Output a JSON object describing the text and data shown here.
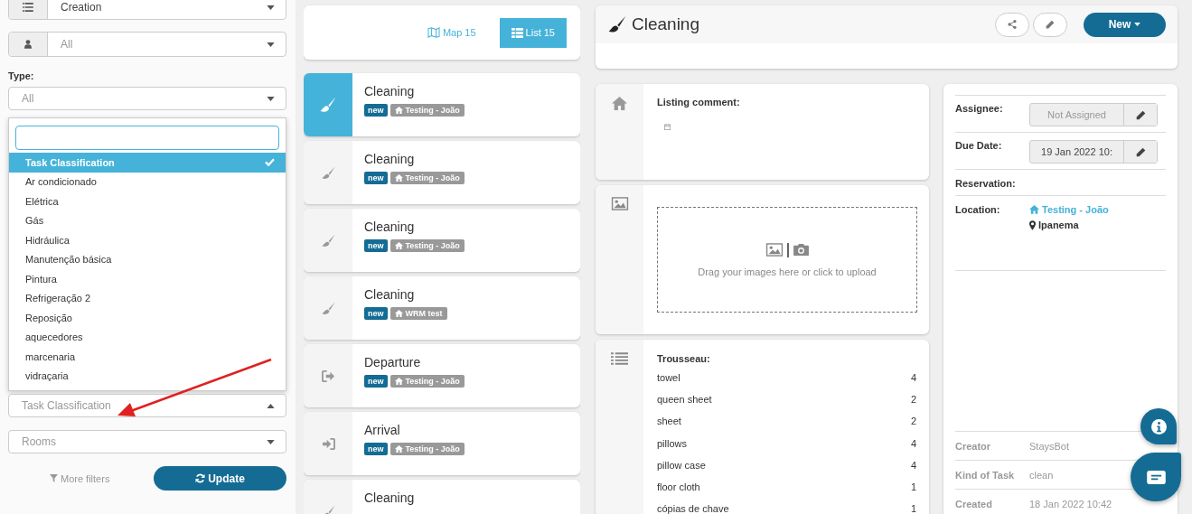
{
  "filters": {
    "order_select": {
      "value": "Creation"
    },
    "person_select": {
      "value": "All"
    },
    "type": {
      "label": "Type:",
      "value": "All"
    },
    "classification_select": {
      "placeholder": "Task Classification",
      "expanded": true
    },
    "classification_options": [
      {
        "label": "Task Classification",
        "selected": true
      },
      {
        "label": "Ar condicionado",
        "selected": false
      },
      {
        "label": "Elétrica",
        "selected": false
      },
      {
        "label": "Gás",
        "selected": false
      },
      {
        "label": "Hidráulica",
        "selected": false
      },
      {
        "label": "Manutenção básica",
        "selected": false
      },
      {
        "label": "Pintura",
        "selected": false
      },
      {
        "label": "Refrigeração 2",
        "selected": false
      },
      {
        "label": "Reposição",
        "selected": false
      },
      {
        "label": "aquecedores",
        "selected": false
      },
      {
        "label": "marcenaria",
        "selected": false
      },
      {
        "label": "vidraçaria",
        "selected": false
      }
    ],
    "rooms_select": {
      "placeholder": "Rooms"
    },
    "more_filters": "More filters",
    "update_button": "Update"
  },
  "view_toggle": [
    {
      "label": "Map 15",
      "kind": "map",
      "selected": false
    },
    {
      "label": "List 15",
      "kind": "list",
      "selected": true
    }
  ],
  "tasks": [
    {
      "title": "Cleaning",
      "kind": "cleaning",
      "selected": true,
      "status": "new",
      "location": "Testing - João"
    },
    {
      "title": "Cleaning",
      "kind": "cleaning",
      "selected": false,
      "status": "new",
      "location": "Testing - João"
    },
    {
      "title": "Cleaning",
      "kind": "cleaning",
      "selected": false,
      "status": "new",
      "location": "Testing - João"
    },
    {
      "title": "Cleaning",
      "kind": "cleaning",
      "selected": false,
      "status": "new",
      "location": "WRM test"
    },
    {
      "title": "Departure",
      "kind": "departure",
      "selected": false,
      "status": "new",
      "location": "Testing - João"
    },
    {
      "title": "Arrival",
      "kind": "arrival",
      "selected": false,
      "status": "new",
      "location": "Testing - João"
    },
    {
      "title": "Cleaning",
      "kind": "cleaning",
      "selected": false
    }
  ],
  "detail": {
    "title": "Cleaning",
    "new_button": "New",
    "listing_comment": {
      "label": "Listing comment:"
    },
    "upload": {
      "text": "Drag your images here or click to upload"
    },
    "trousseau": {
      "label": "Trousseau:",
      "items": [
        {
          "name": "towel",
          "quantity": "4"
        },
        {
          "name": "queen sheet",
          "quantity": "2"
        },
        {
          "name": "sheet",
          "quantity": "2"
        },
        {
          "name": "pillows",
          "quantity": "4"
        },
        {
          "name": "pillow case",
          "quantity": "4"
        },
        {
          "name": "floor cloth",
          "quantity": "1"
        },
        {
          "name": "cópias de chave",
          "quantity": "1"
        }
      ]
    },
    "assignee": {
      "label": "Assignee:",
      "value": "Not Assigned"
    },
    "due_date": {
      "label": "Due Date:",
      "value": "19 Jan 2022 10:"
    },
    "reservation": {
      "label": "Reservation:"
    },
    "location": {
      "label": "Location:",
      "property": "Testing - João",
      "neighborhood": "Ipanema"
    },
    "meta": [
      {
        "label": "Creator",
        "value": "StaysBot"
      },
      {
        "label": "Kind of Task",
        "value": "clean"
      },
      {
        "label": "Created",
        "value": "18 Jan 2022 10:42"
      }
    ]
  }
}
